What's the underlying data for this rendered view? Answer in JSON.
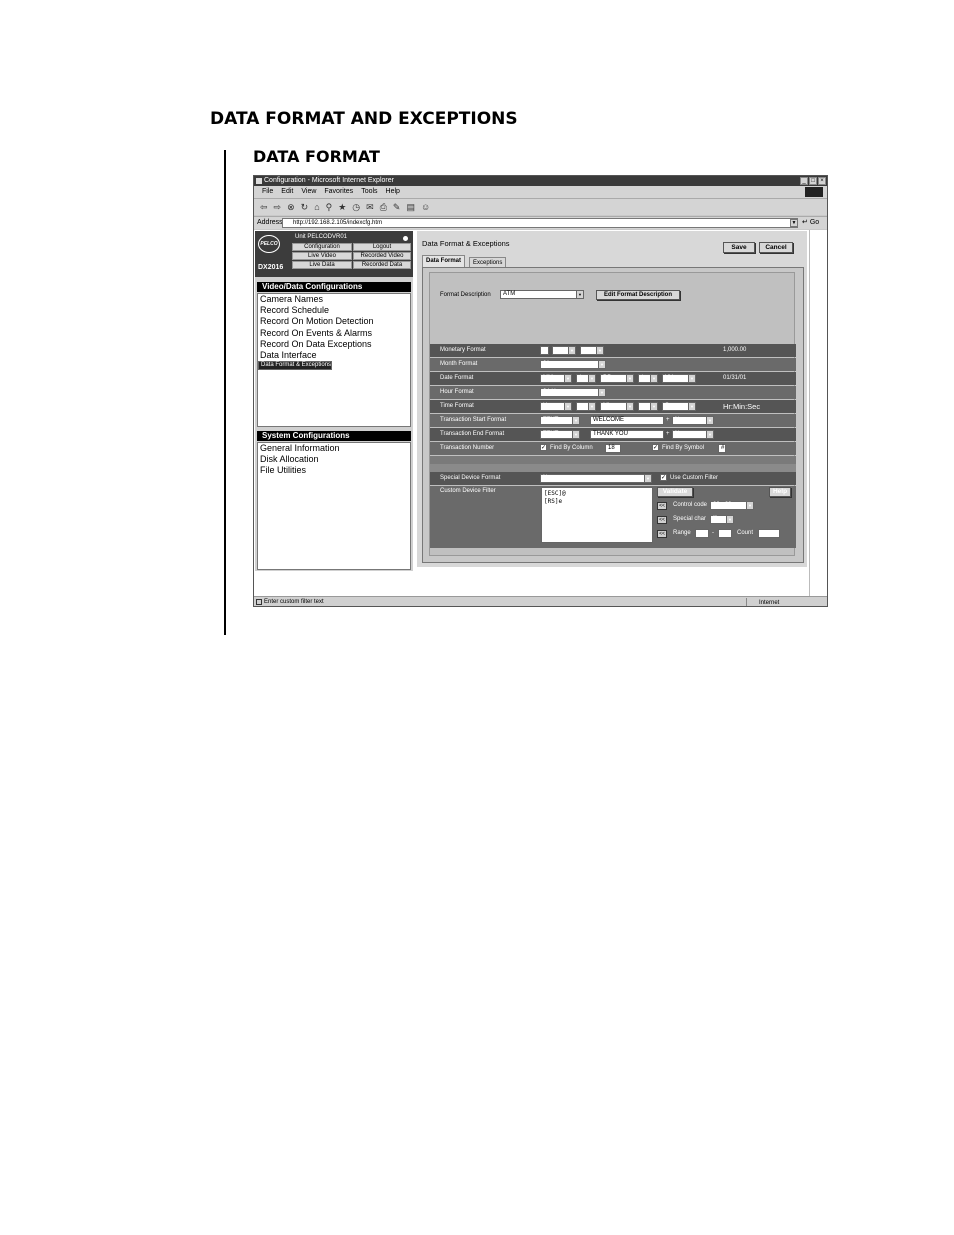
{
  "document": {
    "heading": "DATA FORMAT AND EXCEPTIONS",
    "subheading": "DATA FORMAT"
  },
  "browser": {
    "window_title": "Configuration - Microsoft Internet Explorer",
    "menu": [
      "File",
      "Edit",
      "View",
      "Favorites",
      "Tools",
      "Help"
    ],
    "address_label": "Address",
    "address_url": "http://192.168.2.105/indexcfg.htm",
    "go_label": "Go",
    "status_text": "Enter custom filter text",
    "zone_text": "Internet"
  },
  "unit": {
    "logo": "PELCO",
    "model": "DX2016",
    "unit_label": "Unit  PELCODVR01",
    "buttons": {
      "configuration": "Configuration",
      "logout": "Logout",
      "live_video": "Live Video",
      "recorded_video": "Recorded Video",
      "live_data": "Live Data",
      "recorded_data": "Recorded Data"
    }
  },
  "video_panel": {
    "title": "Video/Data Configurations",
    "items": [
      "Camera Names",
      "Record Schedule",
      "Record On Motion Detection",
      "Record On Events & Alarms",
      "Record On Data Exceptions",
      "Data Interface",
      "Data Format & Exceptions"
    ]
  },
  "system_panel": {
    "title": "System Configurations",
    "items": [
      "General Information",
      "Disk Allocation",
      "File Utilities"
    ]
  },
  "main": {
    "title": "Data Format & Exceptions",
    "save": "Save",
    "cancel": "Cancel",
    "tabs": [
      "Data Format",
      "Exceptions"
    ],
    "format_description_label": "Format Description",
    "format_description_value": "ATM",
    "edit_format_button": "Edit Format Description",
    "monetary": {
      "label": "Monetary Format",
      "sel1": "",
      "sel2": ",",
      "sel3": ".",
      "example": "1,000.00"
    },
    "month": {
      "label": "Month Format",
      "value": "01"
    },
    "date": {
      "label": "Date Format",
      "p1": "MM",
      "s1": "/",
      "p2": "DD",
      "s2": "/",
      "p3": "YY",
      "example": "01/31/01"
    },
    "hour": {
      "label": "Hour Format",
      "value": "24 Hour"
    },
    "time": {
      "label": "Time Format",
      "p1": "Hr",
      "s1": ":",
      "p2": "Min",
      "s2": ":",
      "p3": "Sec",
      "example": "Hr:Min:Sec"
    },
    "tx_start": {
      "label": "Transaction Start Format",
      "type": "TEXT",
      "text": "WELCOME",
      "plus": "+",
      "extra": "None"
    },
    "tx_end": {
      "label": "Transaction End Format",
      "type": "TEXT",
      "text": "THANK YOU",
      "plus": "+",
      "extra": "None"
    },
    "tx_number": {
      "label": "Transaction Number",
      "find_col": "Find By Column",
      "col_value": "18",
      "find_sym": "Find By Symbol",
      "sym_value": "#"
    },
    "special_device": {
      "label": "Special Device Format",
      "value": "None",
      "use_custom": "Use Custom Filter"
    },
    "custom_filter": {
      "label": "Custom Device Filter",
      "lines": [
        "[ESC]@",
        "[RS]e"
      ],
      "validate": "Validate",
      "help": "Help",
      "cc": "<<",
      "control_code_label": "Control code",
      "control_code_value": "09 <29>",
      "special_char_label": "Special char",
      "special_char_value": "'['",
      "range_label": "Range",
      "range_dash": "-",
      "count_label": "Count"
    }
  }
}
